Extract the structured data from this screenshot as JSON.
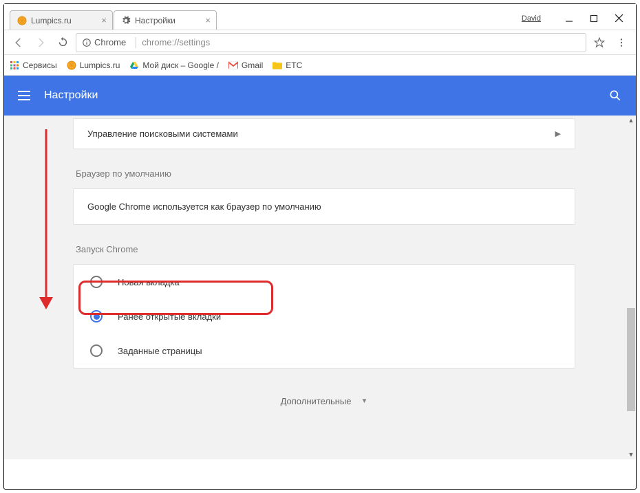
{
  "titlebar": {
    "user_label": "David",
    "tabs": [
      {
        "label": "Lumpics.ru",
        "icon": "orange"
      },
      {
        "label": "Настройки",
        "icon": "gear"
      }
    ]
  },
  "toolbar": {
    "secure_label": "Chrome",
    "url_gray": "chrome://settings"
  },
  "bookmarks": {
    "items": [
      {
        "label": "Сервисы",
        "icon": "apps"
      },
      {
        "label": "Lumpics.ru",
        "icon": "orange"
      },
      {
        "label": "Мой диск – Google /",
        "icon": "drive"
      },
      {
        "label": "Gmail",
        "icon": "gmail"
      },
      {
        "label": "ETC",
        "icon": "folder"
      }
    ]
  },
  "settings": {
    "header_title": "Настройки",
    "search_engines_row": "Управление поисковыми системами",
    "default_browser_label": "Браузер по умолчанию",
    "default_browser_text": "Google Chrome используется как браузер по умолчанию",
    "startup_label": "Запуск Chrome",
    "startup_options": [
      {
        "label": "Новая вкладка",
        "checked": false
      },
      {
        "label": "Ранее открытые вкладки",
        "checked": true
      },
      {
        "label": "Заданные страницы",
        "checked": false
      }
    ],
    "more_label": "Дополнительные"
  }
}
